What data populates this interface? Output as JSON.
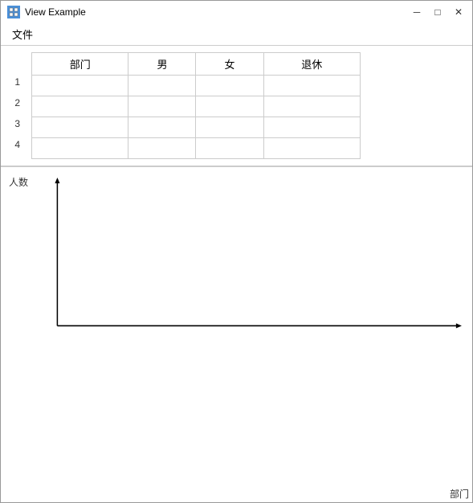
{
  "window": {
    "title": "View Example",
    "icon": "▣"
  },
  "title_controls": {
    "minimize": "─",
    "maximize": "□",
    "close": "✕"
  },
  "menu": {
    "items": [
      "文件"
    ]
  },
  "table": {
    "headers": [
      "部门",
      "男",
      "女",
      "退休"
    ],
    "rows": [
      {
        "num": "1",
        "cells": [
          "",
          "",
          "",
          ""
        ]
      },
      {
        "num": "2",
        "cells": [
          "",
          "",
          "",
          ""
        ]
      },
      {
        "num": "3",
        "cells": [
          "",
          "",
          "",
          ""
        ]
      },
      {
        "num": "4",
        "cells": [
          "",
          "",
          "",
          ""
        ]
      }
    ]
  },
  "chart": {
    "y_label": "人数",
    "x_label": "部门"
  }
}
